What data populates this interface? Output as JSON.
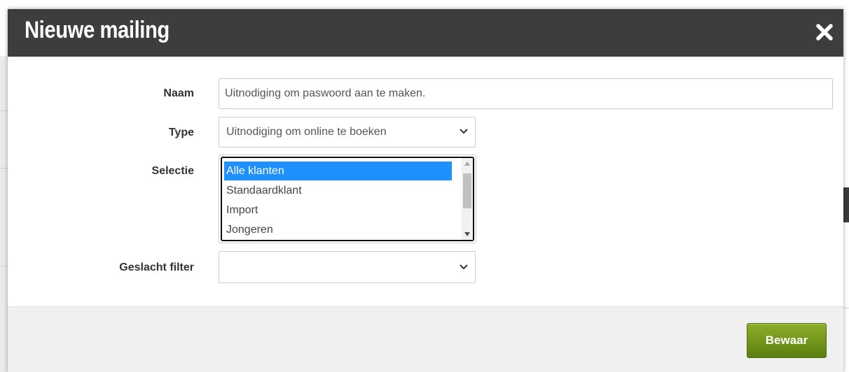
{
  "modal": {
    "title": "Nieuwe mailing",
    "close_icon": "close-icon"
  },
  "form": {
    "naam": {
      "label": "Naam",
      "value": "Uitnodiging om paswoord aan te maken."
    },
    "type": {
      "label": "Type",
      "selected": "Uitnodiging om online te boeken"
    },
    "selectie": {
      "label": "Selectie",
      "options": [
        "Alle klanten",
        "Standaardklant",
        "Import",
        "Jongeren"
      ],
      "selected_index": 0
    },
    "geslacht": {
      "label": "Geslacht filter",
      "selected": ""
    }
  },
  "footer": {
    "save_label": "Bewaar"
  },
  "colors": {
    "header_bg": "#3d3d3d",
    "accent_selection": "#1e90ff",
    "save_button": "#6f9419"
  }
}
